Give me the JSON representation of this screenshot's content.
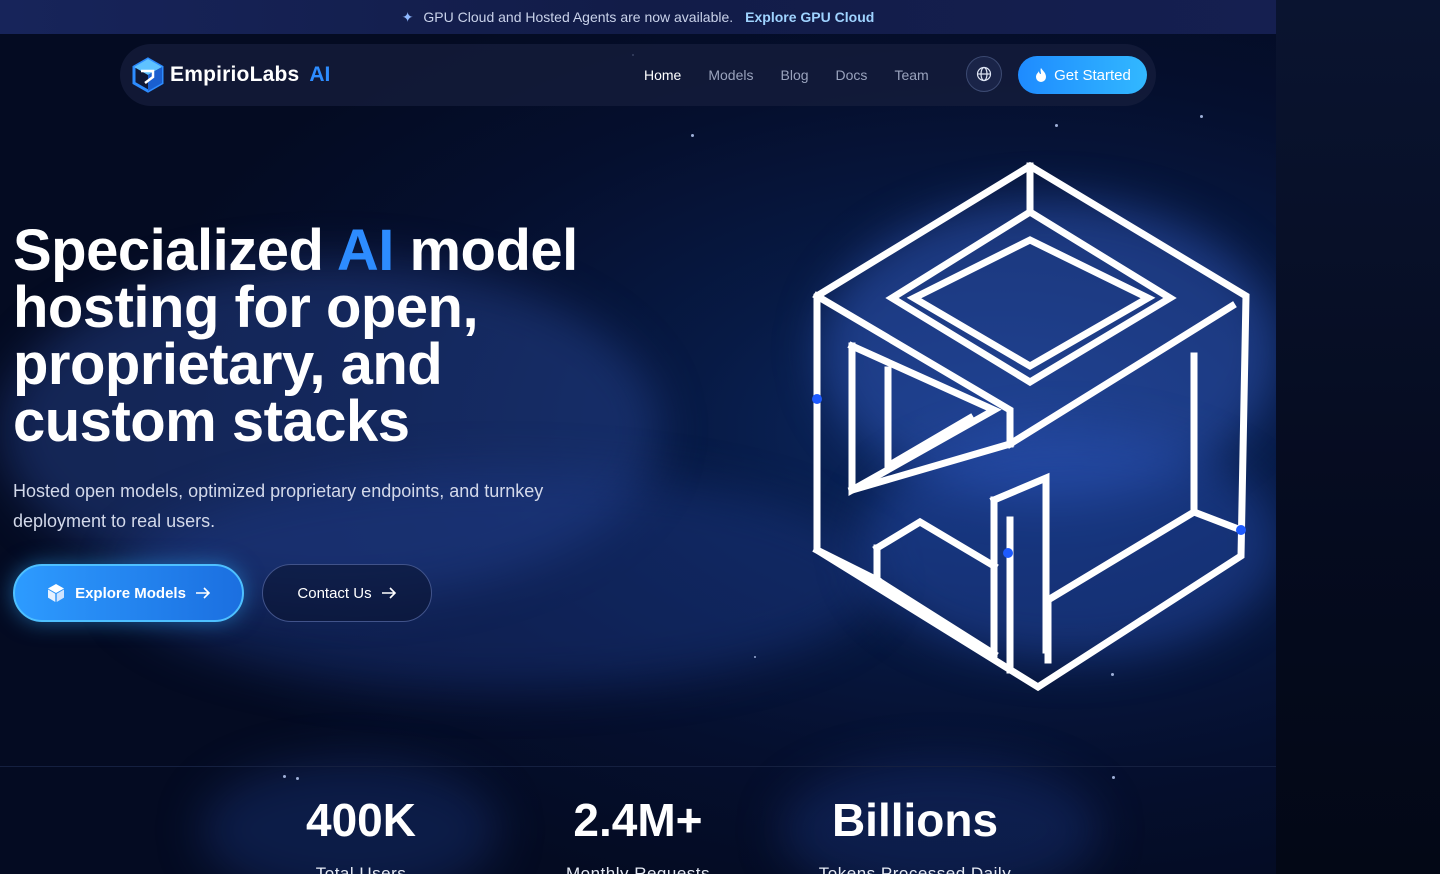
{
  "announcement": {
    "message": "GPU Cloud and Hosted Agents are now available.",
    "link_label": "Explore GPU Cloud",
    "icon": "sparkle-icon"
  },
  "nav": {
    "brand": "EmpirioLabs",
    "brand_suffix": "AI",
    "links": [
      "Home",
      "Models",
      "Blog",
      "Docs",
      "Team"
    ],
    "active_link": "Home",
    "language_icon": "globe-icon",
    "cta_label": "Get Started",
    "cta_icon": "flame-icon"
  },
  "hero": {
    "title_part1": "Specialized ",
    "title_accent": "AI",
    "title_part2": " model hosting for open, proprietary, and custom stacks",
    "subtitle": "Hosted open models, optimized proprietary endpoints, and turnkey deployment to real users.",
    "primary_button": "Explore Models",
    "primary_icon": "cube-icon",
    "secondary_button": "Contact Us",
    "button_arrow_icon": "arrow-right-icon",
    "illustration": "isometric-maze-cube"
  },
  "stats": [
    {
      "value": "400K",
      "label": "Total Users"
    },
    {
      "value": "2.4M+",
      "label": "Monthly Requests"
    },
    {
      "value": "Billions",
      "label": "Tokens Processed Daily"
    }
  ],
  "colors": {
    "accent": "#2d8cff",
    "cta_gradient_start": "#1e8bff",
    "cta_gradient_end": "#32b8ff",
    "background": "#040b22"
  }
}
